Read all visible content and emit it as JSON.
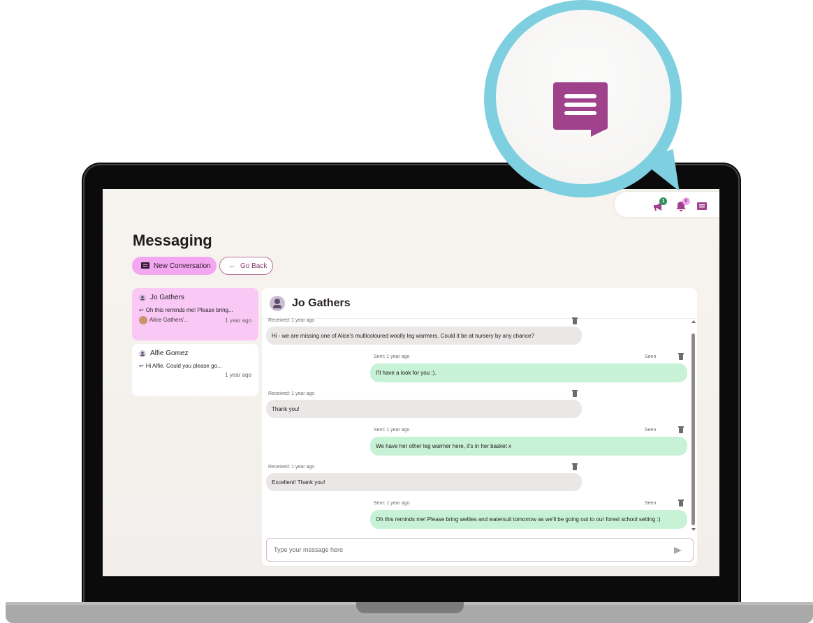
{
  "colors": {
    "accent_pink": "#f2a7f0",
    "active_conv": "#f9c8f5",
    "sent_bubble": "#c8f2d5",
    "received_bubble": "#e9e8e7",
    "brand_purple": "#a0418b",
    "magnifier_ring": "#7ecfe0"
  },
  "topbar": {
    "icons": [
      "megaphone-icon",
      "bell-icon",
      "message-icon"
    ],
    "badges": {
      "announcements": "1",
      "notifications": "0"
    }
  },
  "page": {
    "title": "Messaging",
    "new_conversation_label": "New Conversation",
    "go_back_label": "Go Back"
  },
  "conversations": [
    {
      "name": "Jo Gathers",
      "snippet": "Oh this reminds me! Please bring...",
      "child": "Alice Gathers'...",
      "time": "1 year ago",
      "active": true
    },
    {
      "name": "Alfie Gomez",
      "snippet": "Hi Alfie. Could you please go...",
      "child": "",
      "time": "1 year ago",
      "active": false
    }
  ],
  "chat": {
    "title": "Jo Gathers",
    "messages": [
      {
        "direction": "received",
        "meta": "Received: 1 year ago",
        "text": "Hi - we are missing one of Alice's multicoloured woolly leg warmers. Could it be at nursery by any chance?"
      },
      {
        "direction": "sent",
        "meta": "Sent: 1 year ago",
        "status": "Seen",
        "text": "I'll have a look for you :)."
      },
      {
        "direction": "received",
        "meta": "Received: 1 year ago",
        "text": "Thank you!"
      },
      {
        "direction": "sent",
        "meta": "Sent: 1 year ago",
        "status": "Seen",
        "text": "We have her other leg warmer here, it's in her basket x"
      },
      {
        "direction": "received",
        "meta": "Received: 1 year ago",
        "text": "Excellent! Thank you!"
      },
      {
        "direction": "sent",
        "meta": "Sent: 1 year ago",
        "status": "Seen",
        "text": "Oh this reminds me! Please bring wellies and watersuit tomorrow as we'll be going out to our forest school setting :)"
      }
    ],
    "input_placeholder": "Type your message here"
  }
}
